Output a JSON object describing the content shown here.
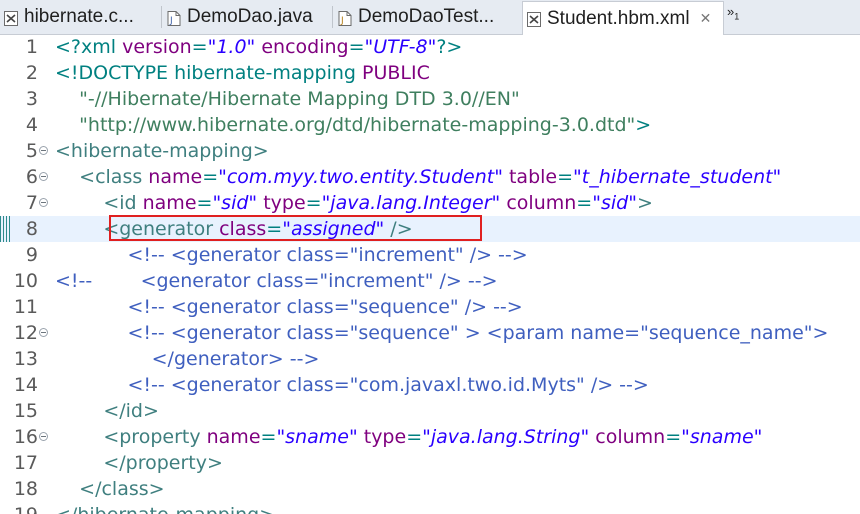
{
  "tabs": [
    {
      "label": "hibernate.c...",
      "icon": "xml-file-icon",
      "active": false
    },
    {
      "label": "DemoDao.java",
      "icon": "java-file-icon",
      "active": false
    },
    {
      "label": "DemoDaoTest...",
      "icon": "java-test-file-icon",
      "active": false
    },
    {
      "label": "Student.hbm.xml",
      "icon": "xml-file-icon",
      "active": true,
      "close": "✕"
    }
  ],
  "overflow": {
    "symbol": "»",
    "count": "1"
  },
  "editor": {
    "current_line": 8,
    "lines": [
      {
        "n": "1",
        "segments": [
          {
            "t": "<?xml ",
            "c": "mk"
          },
          {
            "t": "version",
            "c": "at"
          },
          {
            "t": "=",
            "c": "mk"
          },
          {
            "t": "\"1.0\"",
            "c": "vl"
          },
          {
            "t": " encoding",
            "c": "at"
          },
          {
            "t": "=",
            "c": "mk"
          },
          {
            "t": "\"UTF-8\"",
            "c": "vl"
          },
          {
            "t": "?>",
            "c": "mk"
          }
        ]
      },
      {
        "n": "2",
        "segments": [
          {
            "t": "<!DOCTYPE hibernate-mapping ",
            "c": "dt"
          },
          {
            "t": "PUBLIC",
            "c": "at"
          }
        ]
      },
      {
        "n": "3",
        "segments": [
          {
            "t": "    \"-//Hibernate/Hibernate Mapping DTD 3.0//EN\"",
            "c": "st"
          }
        ]
      },
      {
        "n": "4",
        "segments": [
          {
            "t": "    \"http://www.hibernate.org/dtd/hibernate-mapping-3.0.dtd\"",
            "c": "st"
          },
          {
            "t": ">",
            "c": "dt"
          }
        ]
      },
      {
        "n": "5",
        "fold": true,
        "segments": [
          {
            "t": "<hibernate-mapping>",
            "c": "tg"
          }
        ]
      },
      {
        "n": "6",
        "fold": true,
        "segments": [
          {
            "t": "    <class ",
            "c": "tg"
          },
          {
            "t": "name",
            "c": "at"
          },
          {
            "t": "=",
            "c": "mk"
          },
          {
            "t": "\"com.myy.two.entity.Student\"",
            "c": "vl"
          },
          {
            "t": " table",
            "c": "at"
          },
          {
            "t": "=",
            "c": "mk"
          },
          {
            "t": "\"t_hibernate_student\"",
            "c": "vl"
          }
        ]
      },
      {
        "n": "7",
        "fold": true,
        "segments": [
          {
            "t": "        <id ",
            "c": "tg"
          },
          {
            "t": "name",
            "c": "at"
          },
          {
            "t": "=",
            "c": "mk"
          },
          {
            "t": "\"sid\"",
            "c": "vl"
          },
          {
            "t": " type",
            "c": "at"
          },
          {
            "t": "=",
            "c": "mk"
          },
          {
            "t": "\"java.lang.Integer\"",
            "c": "vl"
          },
          {
            "t": " column",
            "c": "at"
          },
          {
            "t": "=",
            "c": "mk"
          },
          {
            "t": "\"sid\"",
            "c": "vl"
          },
          {
            "t": ">",
            "c": "tg"
          }
        ]
      },
      {
        "n": "8",
        "marker": true,
        "segments": [
          {
            "t": "        <generator ",
            "c": "tg"
          },
          {
            "t": "class",
            "c": "at"
          },
          {
            "t": "=",
            "c": "mk"
          },
          {
            "t": "\"assigned\"",
            "c": "vl"
          },
          {
            "t": " />",
            "c": "tg"
          }
        ]
      },
      {
        "n": "9",
        "segments": [
          {
            "t": "            <!-- <generator class=\"increment\" /> -->",
            "c": "cm"
          }
        ]
      },
      {
        "n": "10",
        "segments": [
          {
            "t": "<!--        <generator class=\"increment\" /> -->",
            "c": "cm"
          }
        ]
      },
      {
        "n": "11",
        "segments": [
          {
            "t": "            <!-- <generator class=\"sequence\" /> -->",
            "c": "cm"
          }
        ]
      },
      {
        "n": "12",
        "fold": true,
        "segments": [
          {
            "t": "            <!-- <generator class=\"sequence\" > <param name=\"sequence_name\">",
            "c": "cm"
          }
        ]
      },
      {
        "n": "13",
        "segments": [
          {
            "t": "                </generator> -->",
            "c": "cm"
          }
        ]
      },
      {
        "n": "14",
        "segments": [
          {
            "t": "            <!-- <generator class=\"com.javaxl.two.id.Myts\" /> -->",
            "c": "cm"
          }
        ]
      },
      {
        "n": "15",
        "segments": [
          {
            "t": "        </id>",
            "c": "tg"
          }
        ]
      },
      {
        "n": "16",
        "fold": true,
        "segments": [
          {
            "t": "        <property ",
            "c": "tg"
          },
          {
            "t": "name",
            "c": "at"
          },
          {
            "t": "=",
            "c": "mk"
          },
          {
            "t": "\"sname\"",
            "c": "vl"
          },
          {
            "t": " type",
            "c": "at"
          },
          {
            "t": "=",
            "c": "mk"
          },
          {
            "t": "\"java.lang.String\"",
            "c": "vl"
          },
          {
            "t": " column",
            "c": "at"
          },
          {
            "t": "=",
            "c": "mk"
          },
          {
            "t": "\"sname\"",
            "c": "vl"
          }
        ]
      },
      {
        "n": "17",
        "segments": [
          {
            "t": "        </property>",
            "c": "tg"
          }
        ]
      },
      {
        "n": "18",
        "segments": [
          {
            "t": "    </class>",
            "c": "tg"
          }
        ]
      },
      {
        "n": "19",
        "segments": [
          {
            "t": "</hibernate-mapping>",
            "c": "tg"
          }
        ]
      }
    ]
  },
  "colors": {
    "highlight_border": "#e02020",
    "current_line_bg": "#e8f2fe"
  }
}
